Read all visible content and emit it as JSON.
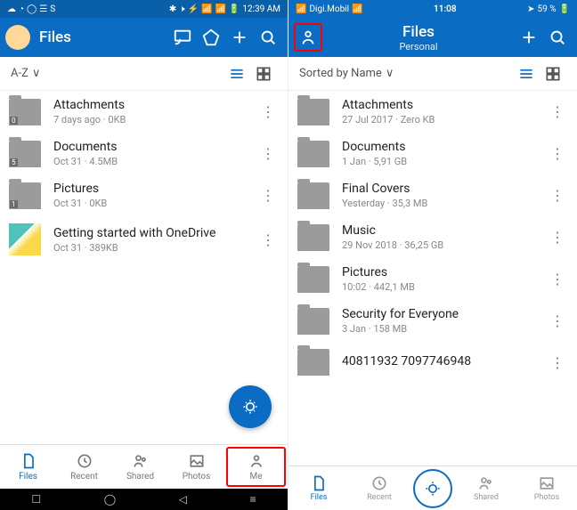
{
  "android": {
    "status": {
      "time": "12:39 AM"
    },
    "header": {
      "title": "Files"
    },
    "sort": {
      "label": "A-Z"
    },
    "items": [
      {
        "name": "Attachments",
        "meta": "7 days ago · 0KB",
        "badge": "0"
      },
      {
        "name": "Documents",
        "meta": "Oct 31 · 4.5MB",
        "badge": "5"
      },
      {
        "name": "Pictures",
        "meta": "Oct 31 · 0KB",
        "badge": "1"
      },
      {
        "name": "Getting started with OneDrive",
        "meta": "Oct 31 · 389KB",
        "img": true
      }
    ],
    "tabs": {
      "files": "Files",
      "recent": "Recent",
      "shared": "Shared",
      "photos": "Photos",
      "me": "Me"
    }
  },
  "ios": {
    "status": {
      "carrier": "Digi.Mobil",
      "time": "11:08",
      "battery": "59 %"
    },
    "header": {
      "title": "Files",
      "subtitle": "Personal"
    },
    "sort": {
      "label": "Sorted by Name"
    },
    "items": [
      {
        "name": "Attachments",
        "meta": "27 Jul 2017 · Zero KB"
      },
      {
        "name": "Documents",
        "meta": "1 Jan · 5,91 GB"
      },
      {
        "name": "Final Covers",
        "meta": "Yesterday · 35,3 MB"
      },
      {
        "name": "Music",
        "meta": "29 Nov 2018 · 36,25 GB"
      },
      {
        "name": "Pictures",
        "meta": "10:02 · 442,1 MB"
      },
      {
        "name": "Security for Everyone",
        "meta": "3 Jan · 158 MB"
      },
      {
        "name": "40811932         7097746948",
        "meta": ""
      }
    ],
    "tabs": {
      "files": "Files",
      "recent": "Recent",
      "shared": "Shared",
      "photos": "Photos"
    }
  }
}
